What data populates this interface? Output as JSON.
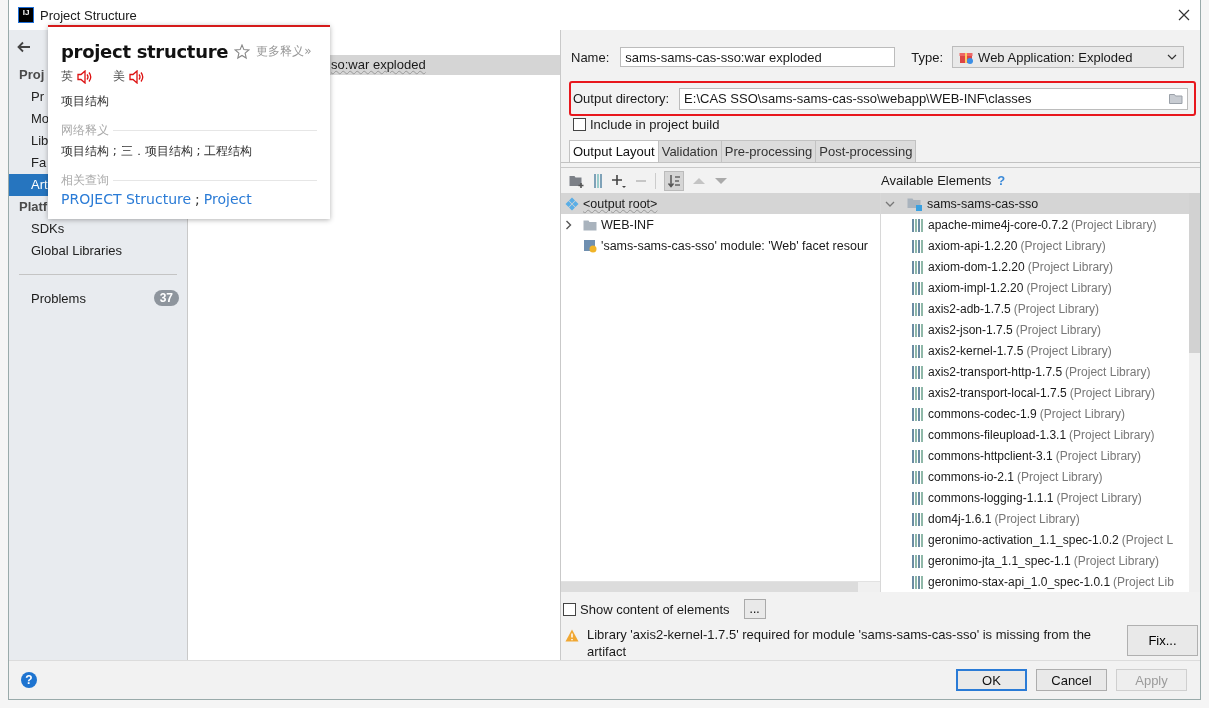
{
  "window": {
    "title": "Project Structure",
    "logo_text": "IJ"
  },
  "sidebar": {
    "sections": [
      {
        "heading": "Proj",
        "items": [
          {
            "label": "Pr",
            "selected": false
          },
          {
            "label": "Mo",
            "selected": false
          },
          {
            "label": "Lib",
            "selected": false
          },
          {
            "label": "Fa",
            "selected": false
          },
          {
            "label": "Art",
            "selected": true
          }
        ]
      },
      {
        "heading": "Platf",
        "items": [
          {
            "label": "SDKs",
            "selected": false
          },
          {
            "label": "Global Libraries",
            "selected": false
          }
        ]
      }
    ],
    "problems": {
      "label": "Problems",
      "count": "37"
    }
  },
  "artifacts": [
    {
      "label": "so:war exploded",
      "selected": true
    }
  ],
  "popup": {
    "word": "project structure",
    "more": "更多释义»",
    "pronunciations": [
      {
        "label": "英"
      },
      {
        "label": "美"
      }
    ],
    "meaning": "项目结构",
    "web_heading": "网络释义",
    "web_meaning": "项目结构 ; 三．项目结构 ; 工程结构",
    "related_heading": "相关查询",
    "related_links": [
      "PROJECT Structure",
      "Project"
    ],
    "separator": ";"
  },
  "form": {
    "name_label": "Name:",
    "name_value": "sams-sams-cas-sso:war exploded",
    "type_label": "Type:",
    "type_value": "Web Application: Exploded",
    "output_label": "Output directory:",
    "output_value": "E:\\CAS SSO\\sams-sams-cas-sso\\webapp\\WEB-INF\\classes",
    "output_highlighted": true,
    "include": {
      "label": "Include in project build",
      "checked": false
    }
  },
  "tabs": [
    {
      "label": "Output Layout",
      "selected": true
    },
    {
      "label": "Validation",
      "selected": false
    },
    {
      "label": "Pre-processing",
      "selected": false
    },
    {
      "label": "Post-processing",
      "selected": false
    }
  ],
  "layout_tree": [
    {
      "kind": "root",
      "label": "<output root>",
      "selected": true
    },
    {
      "kind": "folder",
      "label": "WEB-INF",
      "selected": false
    },
    {
      "kind": "facet",
      "label": "'sams-sams-cas-sso' module: 'Web' facet resour",
      "selected": false
    }
  ],
  "available": {
    "heading": "Available Elements",
    "help": "?",
    "module": {
      "label": "sams-sams-cas-sso",
      "expanded": true,
      "selected": true
    },
    "libraries": [
      {
        "name": "apache-mime4j-core-0.7.2",
        "note": "(Project Library)"
      },
      {
        "name": "axiom-api-1.2.20",
        "note": "(Project Library)"
      },
      {
        "name": "axiom-dom-1.2.20",
        "note": "(Project Library)"
      },
      {
        "name": "axiom-impl-1.2.20",
        "note": "(Project Library)"
      },
      {
        "name": "axis2-adb-1.7.5",
        "note": "(Project Library)"
      },
      {
        "name": "axis2-json-1.7.5",
        "note": "(Project Library)"
      },
      {
        "name": "axis2-kernel-1.7.5",
        "note": "(Project Library)"
      },
      {
        "name": "axis2-transport-http-1.7.5",
        "note": "(Project Library)"
      },
      {
        "name": "axis2-transport-local-1.7.5",
        "note": "(Project Library)"
      },
      {
        "name": "commons-codec-1.9",
        "note": "(Project Library)"
      },
      {
        "name": "commons-fileupload-1.3.1",
        "note": "(Project Library)"
      },
      {
        "name": "commons-httpclient-3.1",
        "note": "(Project Library)"
      },
      {
        "name": "commons-io-2.1",
        "note": "(Project Library)"
      },
      {
        "name": "commons-logging-1.1.1",
        "note": "(Project Library)"
      },
      {
        "name": "dom4j-1.6.1",
        "note": "(Project Library)"
      },
      {
        "name": "geronimo-activation_1.1_spec-1.0.2",
        "note": "(Project L"
      },
      {
        "name": "geronimo-jta_1.1_spec-1.1",
        "note": "(Project Library)"
      },
      {
        "name": "geronimo-stax-api_1.0_spec-1.0.1",
        "note": "(Project Lib"
      }
    ]
  },
  "show_content": {
    "label": "Show content of elements",
    "checked": false,
    "button": "..."
  },
  "warning": {
    "text": "Library 'axis2-kernel-1.7.5' required for module 'sams-sams-cas-sso' is missing from the artifact",
    "fix": "Fix..."
  },
  "footer": {
    "help": "?",
    "buttons": [
      {
        "label": "OK",
        "default": true,
        "disabled": false
      },
      {
        "label": "Cancel",
        "default": false,
        "disabled": false
      },
      {
        "label": "Apply",
        "default": false,
        "disabled": true
      }
    ]
  }
}
